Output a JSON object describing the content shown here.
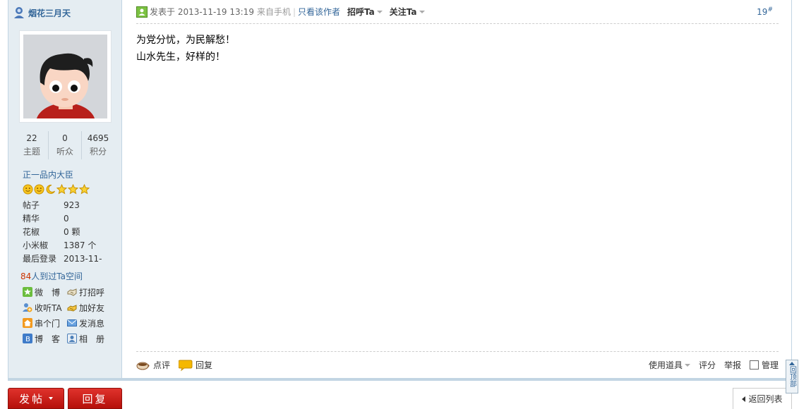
{
  "author": {
    "name": "烟花三月天"
  },
  "stats": [
    {
      "value": "22",
      "label": "主题"
    },
    {
      "value": "0",
      "label": "听众"
    },
    {
      "value": "4695",
      "label": "积分"
    }
  ],
  "rank": "正一品内大臣",
  "info": [
    {
      "key": "帖子",
      "value": "923"
    },
    {
      "key": "精华",
      "value": "0"
    },
    {
      "key": "花椒",
      "value": "0 颗"
    },
    {
      "key": "小米椒",
      "value": "1387 个"
    },
    {
      "key": "最后登录",
      "value": "2013-11-"
    }
  ],
  "visits": {
    "count": "84",
    "text": "人到过Ta空间"
  },
  "links": [
    "微　博",
    "打招呼",
    "收听TA",
    "加好友",
    "串个门",
    "发消息",
    "博　客",
    "相　册"
  ],
  "post": {
    "posted_label": "发表于 2013-11-19 13:19",
    "device": "来自手机",
    "separator": "|",
    "only_author": "只看该作者",
    "greet": "招呼Ta",
    "follow": "关注Ta",
    "floor": "19",
    "floor_mark": "#",
    "lines": [
      "为党分忧，为民解愁！",
      "山水先生，好样的！"
    ]
  },
  "actions": {
    "comment": "点评",
    "reply": "回复",
    "tools": "使用道具",
    "rate": "评分",
    "report": "举报",
    "manage": "管理"
  },
  "buttons": {
    "post": "发帖",
    "reply": "回复",
    "back": "返回列表",
    "totop": "回顶部"
  }
}
